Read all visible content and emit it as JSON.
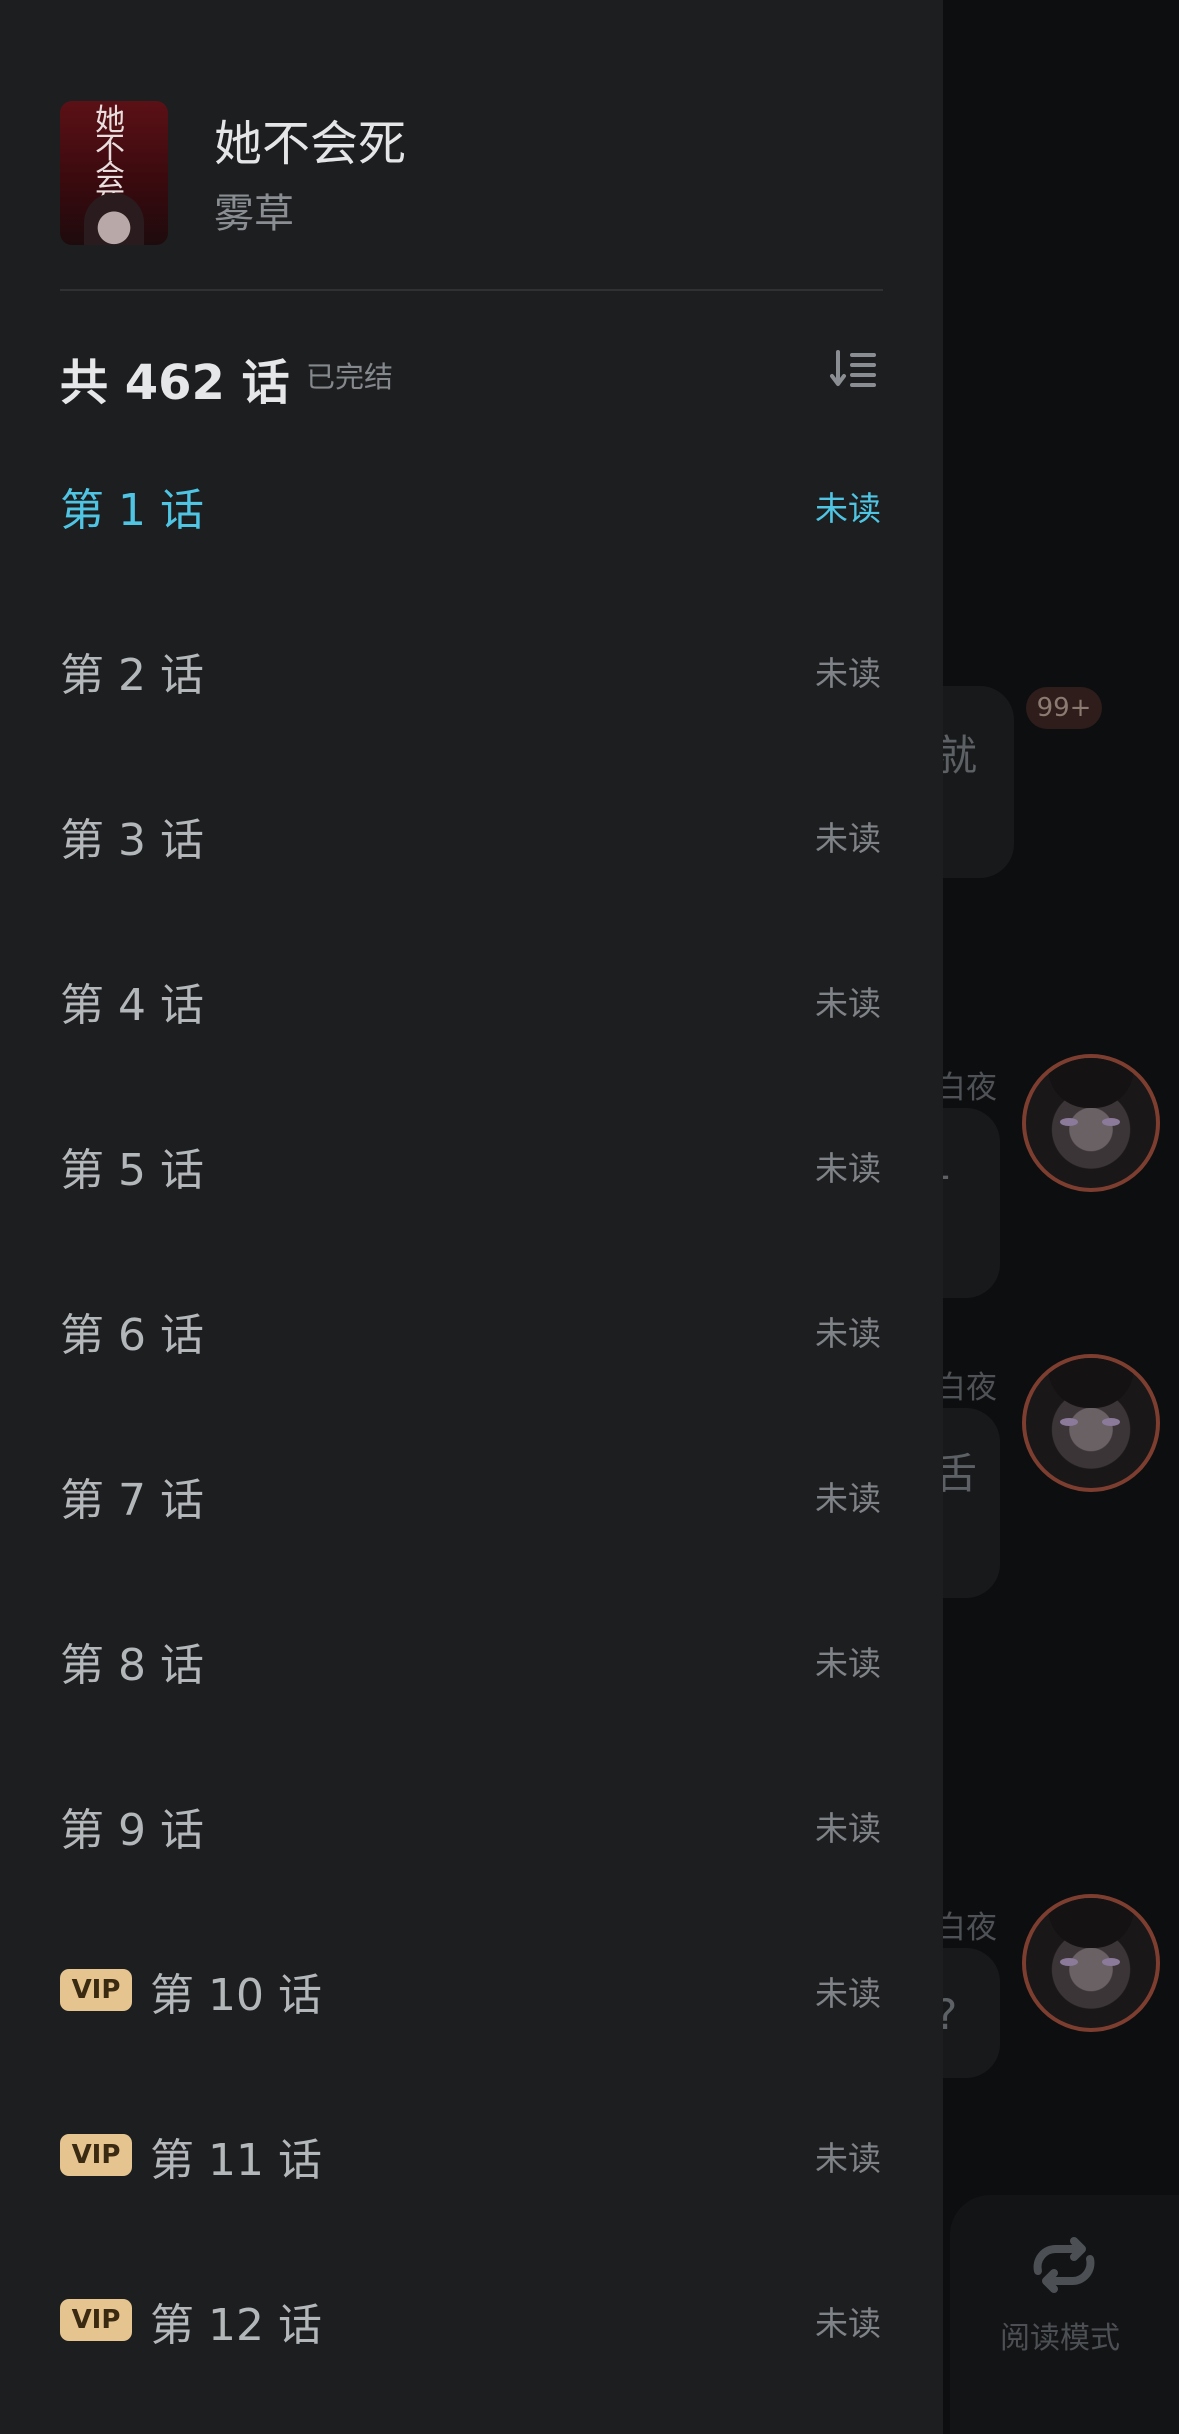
{
  "book": {
    "title": "她不会死",
    "author": "雾草",
    "cover_text": "她不会死",
    "chapter_count": "共 462 话",
    "status": "已完结"
  },
  "chapters": [
    {
      "title": "第 1 话",
      "state": "未读",
      "vip": false,
      "active": true
    },
    {
      "title": "第 2 话",
      "state": "未读",
      "vip": false
    },
    {
      "title": "第 3 话",
      "state": "未读",
      "vip": false
    },
    {
      "title": "第 4 话",
      "state": "未读",
      "vip": false
    },
    {
      "title": "第 5 话",
      "state": "未读",
      "vip": false
    },
    {
      "title": "第 6 话",
      "state": "未读",
      "vip": false
    },
    {
      "title": "第 7 话",
      "state": "未读",
      "vip": false
    },
    {
      "title": "第 8 话",
      "state": "未读",
      "vip": false
    },
    {
      "title": "第 9 话",
      "state": "未读",
      "vip": false
    },
    {
      "title": "第 10 话",
      "state": "未读",
      "vip": true
    },
    {
      "title": "第 11 话",
      "state": "未读",
      "vip": true
    },
    {
      "title": "第 12 话",
      "state": "未读",
      "vip": true
    }
  ],
  "vip_label": "VIP",
  "background": {
    "unread_badge": "99+",
    "bubble_1_text": "就",
    "speaker_name": "白夜",
    "bubble_2_text": "-",
    "bubble_3_text": "舌",
    "bubble_4_text": "?",
    "read_mode_label": "阅读模式"
  },
  "colors": {
    "active_chapter": "#4fc5e3",
    "vip_badge": "#e6c48f",
    "drawer_bg": "#1c1e20"
  },
  "icons": {
    "sort": "sort-order-icon",
    "read_mode": "read-mode-loop-icon"
  }
}
